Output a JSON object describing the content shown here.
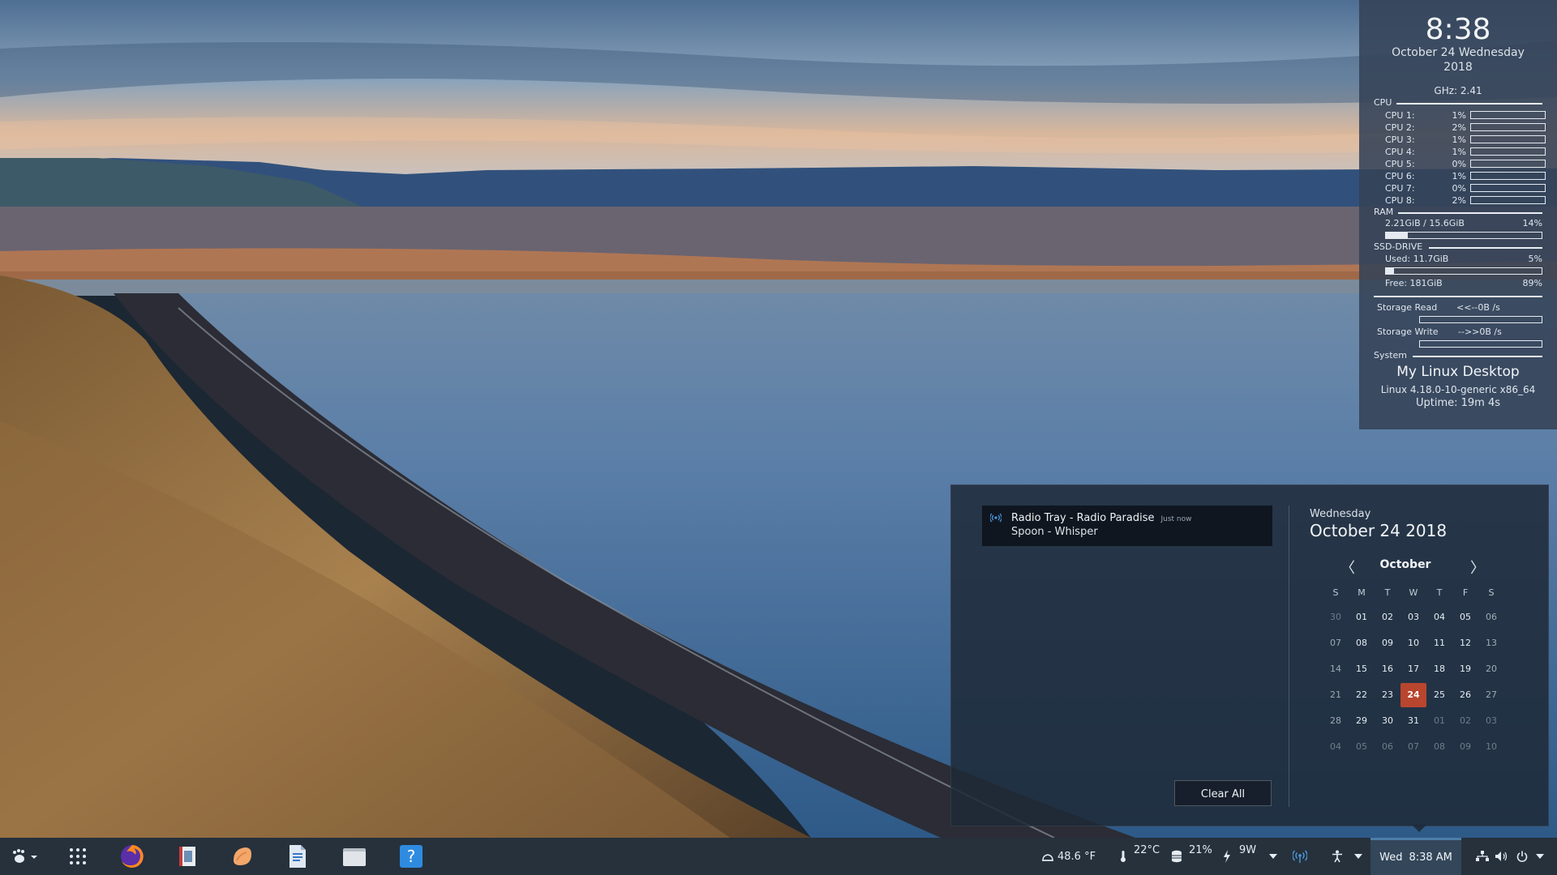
{
  "conky": {
    "time": "8:38",
    "date_line1": "October 24 Wednesday",
    "date_line2": "2018",
    "ghz": "GHz: 2.41",
    "cpu_label": "CPU",
    "cpus": [
      {
        "label": "CPU 1:",
        "pct": "1%"
      },
      {
        "label": "CPU 2:",
        "pct": "2%"
      },
      {
        "label": "CPU 3:",
        "pct": "1%"
      },
      {
        "label": "CPU 4:",
        "pct": "1%"
      },
      {
        "label": "CPU 5:",
        "pct": "0%"
      },
      {
        "label": "CPU 6:",
        "pct": "1%"
      },
      {
        "label": "CPU 7:",
        "pct": "0%"
      },
      {
        "label": "CPU 8:",
        "pct": "2%"
      }
    ],
    "ram_label": "RAM",
    "ram_text": "2.21GiB / 15.6GiB",
    "ram_pct": "14%",
    "ram_fraction": 0.14,
    "ssd_label": "SSD-DRIVE",
    "ssd_used": "Used:  11.7GiB",
    "ssd_used_pct": "5%",
    "ssd_used_fraction": 0.05,
    "ssd_free": "Free:  181GiB",
    "ssd_free_pct": "89%",
    "storage_read_label": "Storage Read",
    "storage_read_value": "<<--0B  /s",
    "storage_write_label": "Storage Write",
    "storage_write_value": "-->>0B  /s",
    "system_label": "System",
    "hostname": "My Linux Desktop",
    "kernel": "Linux 4.18.0-10-generic x86_64",
    "uptime": "Uptime: 19m 4s"
  },
  "notification": {
    "title": "Radio Tray - Radio Paradise",
    "time": "Just now",
    "body": "Spoon - Whisper",
    "icon": "radio-icon"
  },
  "clear_all_label": "Clear All",
  "calendar": {
    "weekday": "Wednesday",
    "full_date": "October 24 2018",
    "month": "October",
    "prev_glyph": "〈",
    "next_glyph": "〉",
    "headers": [
      "S",
      "M",
      "T",
      "W",
      "T",
      "F",
      "S"
    ],
    "weeks": [
      [
        "30",
        "01",
        "02",
        "03",
        "04",
        "05",
        "06"
      ],
      [
        "07",
        "08",
        "09",
        "10",
        "11",
        "12",
        "13"
      ],
      [
        "14",
        "15",
        "16",
        "17",
        "18",
        "19",
        "20"
      ],
      [
        "21",
        "22",
        "23",
        "24",
        "25",
        "26",
        "27"
      ],
      [
        "28",
        "29",
        "30",
        "31",
        "01",
        "02",
        "03"
      ],
      [
        "04",
        "05",
        "06",
        "07",
        "08",
        "09",
        "10"
      ]
    ],
    "today": "24"
  },
  "taskbar": {
    "apps": [
      "app-menu-icon",
      "app-grid-icon",
      "firefox-icon",
      "image-viewer-icon",
      "music-icon",
      "document-icon",
      "file-manager-icon",
      "help-icon"
    ],
    "weather": "48.6 °F",
    "temp": "22°C",
    "storage": "21%",
    "power": "9W",
    "clock_day": "Wed",
    "clock_time": "8:38 AM"
  },
  "colors": {
    "accent": "#4d7ea8",
    "today": "#b8452e",
    "taskbar": "#26313c",
    "conky_bg": "#344256"
  }
}
